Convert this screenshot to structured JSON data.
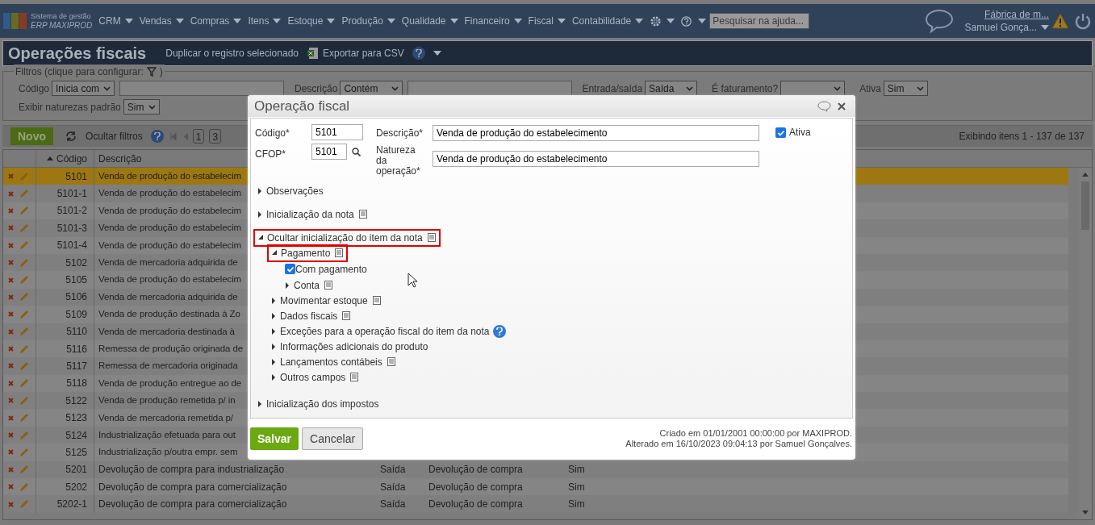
{
  "nav": {
    "logo_line1": "Sistema de gestão",
    "logo_line2": "ERP MAXIPROD",
    "menu": [
      "CRM",
      "Vendas",
      "Compras",
      "Itens",
      "Estoque",
      "Produção",
      "Qualidade",
      "Financeiro",
      "Fiscal",
      "Contabilidade"
    ],
    "search": {
      "placeholder": "Pesquisar na ajuda..."
    },
    "company": "Fábrica de m...",
    "user": "Samuel Gonça..."
  },
  "page": {
    "title": "Operações fiscais",
    "actions": [
      "Duplicar o registro selecionado",
      "Exportar para CSV"
    ]
  },
  "filters": {
    "legend": "Filtros (clique para configurar:",
    "legend_end": ")",
    "fields": [
      {
        "label": "Código",
        "select": "Inicia com",
        "kind": "select_input"
      },
      {
        "label": "Descrição",
        "select": "Contém",
        "kind": "select_input"
      },
      {
        "label": "Entrada/saída",
        "select": "Saída",
        "kind": "select"
      },
      {
        "label": "É faturamento?",
        "kind": "select"
      },
      {
        "label": "Ativa",
        "select": "Sim",
        "kind": "select"
      },
      {
        "label": "Exibir naturezas padrão",
        "select": "Sim",
        "kind": "select"
      }
    ]
  },
  "toolbar": {
    "new": "Novo",
    "hide_filters": "Ocultar filtros",
    "pages": [
      "1",
      "3"
    ],
    "status": "Exibindo itens 1 - 137 de 137"
  },
  "table": {
    "columns": [
      {
        "label": "Código",
        "sorted": true
      },
      {
        "label": "Descrição",
        "sorted": false
      }
    ],
    "rows": [
      {
        "code": "5101",
        "description": "Venda de produção do estabelecim",
        "selected": true
      },
      {
        "code": "5101-1",
        "description": "Venda de produção do estabelecim",
        "selected": false
      },
      {
        "code": "5101-2",
        "description": "Venda de produção do estabelecim",
        "selected": false
      },
      {
        "code": "5101-3",
        "description": "Venda de produção do estabelecim",
        "selected": false
      },
      {
        "code": "5101-4",
        "description": "Venda de produção do estabelecim",
        "selected": false
      },
      {
        "code": "5102",
        "description": "Venda de mercadoria adquirida de",
        "selected": false
      },
      {
        "code": "5105",
        "description": "Venda de produção do estabelecim",
        "selected": false
      },
      {
        "code": "5106",
        "description": "Venda de mercadoria adquirida de",
        "selected": false
      },
      {
        "code": "5109",
        "description": "Venda de produção destinada à Zo",
        "selected": false
      },
      {
        "code": "5110",
        "description": "Venda de mercadoria destinada à",
        "selected": false
      },
      {
        "code": "5116",
        "description": "Remessa de produção originada de",
        "selected": false
      },
      {
        "code": "5117",
        "description": "Remessa de mercadoria originada",
        "selected": false
      },
      {
        "code": "5118",
        "description": "Venda de produção entregue ao de",
        "selected": false
      },
      {
        "code": "5122",
        "description": "Venda de produção remetida p/ in",
        "selected": false
      },
      {
        "code": "5123",
        "description": "Venda de mercadoria remetida p/",
        "selected": false
      },
      {
        "code": "5124",
        "description": "Industrialização efetuada para out",
        "selected": false
      },
      {
        "code": "5125",
        "description": "Industrialização p/outra empr. sem",
        "selected": false
      },
      {
        "code": "5201",
        "description": "Devolução de compra para industrialização",
        "direction": "Saída",
        "nature": "Devolução de compra",
        "active": "Sim",
        "selected": false
      },
      {
        "code": "5202",
        "description": "Devolução de compra para comercialização",
        "direction": "Saída",
        "nature": "Devolução de compra",
        "active": "Sim",
        "selected": false
      },
      {
        "code": "5202-1",
        "description": "Devolução de compra para comercialização",
        "direction": "Saída",
        "nature": "Devolução de compra",
        "active": "Sim",
        "selected": false
      }
    ]
  },
  "modal": {
    "title": "Operação fiscal",
    "code_label": "Código*",
    "code": "5101",
    "cfop_label": "CFOP*",
    "cfop": "5101",
    "description_label": "Descrição*",
    "description": "Venda de produção do estabelecimento",
    "nature_label": "Natureza da operação*",
    "nature": "Venda de produção do estabelecimento",
    "active_label": "Ativa",
    "active": true,
    "tree": [
      {
        "label": "Observações",
        "kind": "plain",
        "expanded": false,
        "highlighted": false
      },
      {
        "label": "Inicialização da nota",
        "kind": "notes",
        "expanded": false,
        "highlighted": false
      },
      {
        "label": "Ocultar inicialização do item da nota",
        "kind": "notes",
        "expanded": true,
        "highlighted": true,
        "children": [
          {
            "label": "Pagamento",
            "kind": "notes",
            "expanded": true,
            "highlighted": true,
            "children": [
              {
                "label": "Com pagamento",
                "kind": "checkbox",
                "checked": true
              },
              {
                "label": "Conta",
                "kind": "notes",
                "expanded": false,
                "highlighted": false
              }
            ]
          },
          {
            "label": "Movimentar estoque",
            "kind": "notes",
            "expanded": false,
            "highlighted": false
          },
          {
            "label": "Dados fiscais",
            "kind": "notes",
            "expanded": false,
            "highlighted": false
          },
          {
            "label": "Exceções para a operação fiscal do item da nota",
            "kind": "help",
            "expanded": false,
            "highlighted": false
          },
          {
            "label": "Informações adicionais do produto",
            "kind": "plain",
            "expanded": false,
            "highlighted": false
          },
          {
            "label": "Lançamentos contábeis",
            "kind": "notes",
            "expanded": false,
            "highlighted": false
          },
          {
            "label": "Outros campos",
            "kind": "notes",
            "expanded": false,
            "highlighted": false
          }
        ]
      },
      {
        "label": "Inicialização dos impostos",
        "kind": "plain",
        "expanded": false,
        "highlighted": false
      }
    ],
    "save": "Salvar",
    "cancel": "Cancelar",
    "created": "Criado em 01/01/2001 00:00:00 por MAXIPROD.",
    "modified": "Alterado em 16/10/2023 09:04:13 por Samuel Gonçalves."
  }
}
